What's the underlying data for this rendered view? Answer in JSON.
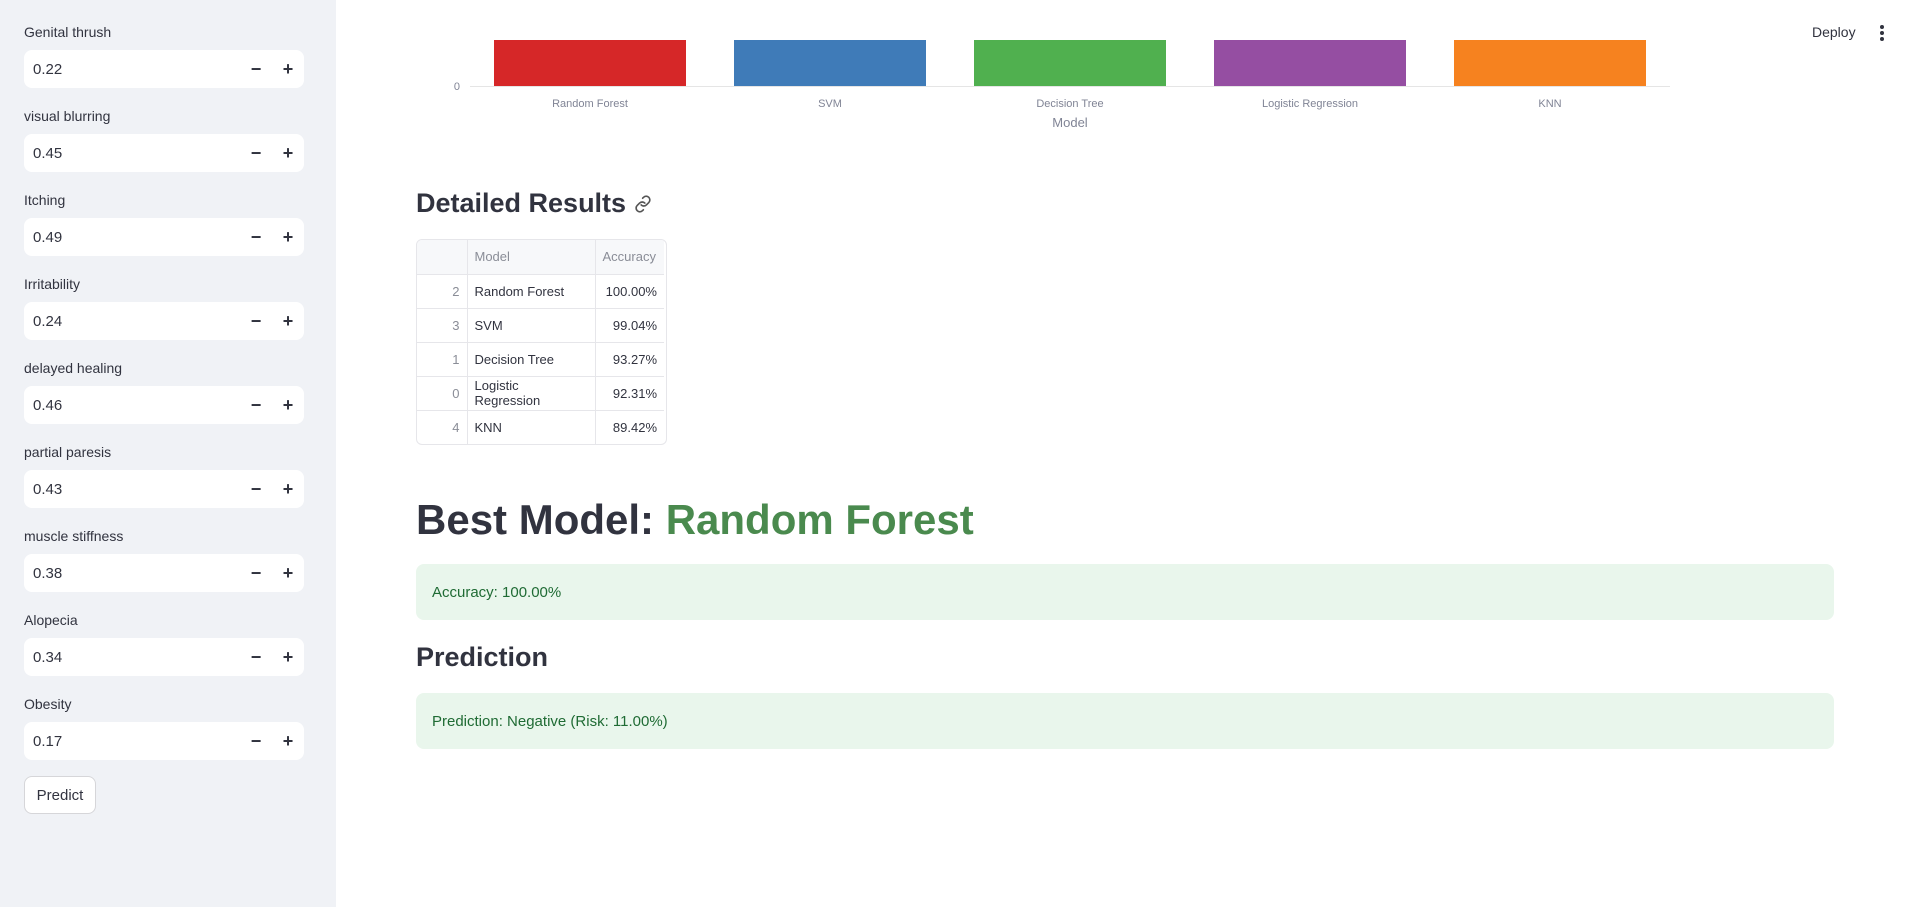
{
  "sidebar": {
    "fields": [
      {
        "label": "Genital thrush",
        "value": "0.22"
      },
      {
        "label": "visual blurring",
        "value": "0.45"
      },
      {
        "label": "Itching",
        "value": "0.49"
      },
      {
        "label": "Irritability",
        "value": "0.24"
      },
      {
        "label": "delayed healing",
        "value": "0.46"
      },
      {
        "label": "partial paresis",
        "value": "0.43"
      },
      {
        "label": "muscle stiffness",
        "value": "0.38"
      },
      {
        "label": "Alopecia",
        "value": "0.34"
      },
      {
        "label": "Obesity",
        "value": "0.17"
      }
    ],
    "minus": "−",
    "plus": "+",
    "predict_label": "Predict"
  },
  "header": {
    "deploy_label": "Deploy",
    "menu_icon": "kebab-menu-icon"
  },
  "chart_data": {
    "type": "bar",
    "categories": [
      "Random Forest",
      "SVM",
      "Decision Tree",
      "Logistic Regression",
      "KNN"
    ],
    "colors": [
      "#d62728",
      "#3f7bb8",
      "#50b04f",
      "#954ea2",
      "#f6821f"
    ],
    "xlabel": "Model",
    "yticks": [
      "0"
    ]
  },
  "results": {
    "title": "Detailed Results",
    "link_icon": "link-icon",
    "columns": [
      "",
      "Model",
      "Accuracy"
    ],
    "rows": [
      {
        "idx": "2",
        "model": "Random Forest",
        "accuracy": "100.00%"
      },
      {
        "idx": "3",
        "model": "SVM",
        "accuracy": "99.04%"
      },
      {
        "idx": "1",
        "model": "Decision Tree",
        "accuracy": "93.27%"
      },
      {
        "idx": "0",
        "model": "Logistic Regression",
        "accuracy": "92.31%"
      },
      {
        "idx": "4",
        "model": "KNN",
        "accuracy": "89.42%"
      }
    ]
  },
  "best": {
    "prefix": "Best Model: ",
    "name": "Random Forest",
    "accuracy_text": "Accuracy: 100.00%"
  },
  "prediction": {
    "title": "Prediction",
    "text": "Prediction: Negative (Risk: 11.00%)"
  }
}
